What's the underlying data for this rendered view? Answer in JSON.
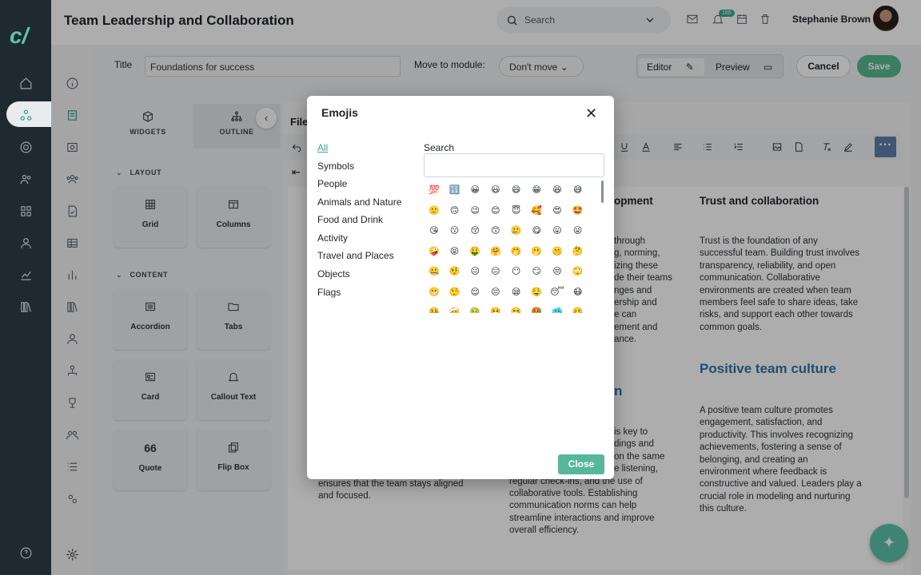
{
  "header": {
    "page_title": "Team Leadership and Collaboration",
    "search_placeholder": "Search",
    "notification_count": "165",
    "user_name": "Stephanie Brown"
  },
  "lesson": {
    "title_label": "Title",
    "title_value": "Foundations for success",
    "move_label": "Move to module:",
    "move_value": "Don't move",
    "editor_label": "Editor",
    "preview_label": "Preview",
    "cancel_label": "Cancel",
    "save_label": "Save"
  },
  "widgets": {
    "tabs": [
      "WIDGETS",
      "OUTLINE"
    ],
    "layout_label": "LAYOUT",
    "content_label": "CONTENT",
    "layout_items": [
      "Grid",
      "Columns"
    ],
    "content_items": [
      "Accordion",
      "Tabs",
      "Card",
      "Callout Text",
      "Quote",
      "Flip Box"
    ]
  },
  "editor": {
    "file_label": "File",
    "col2_heading": "opment",
    "col2_top": [
      "through",
      "g, norming,",
      "izing these",
      "de their teams",
      "nges and",
      "ership and",
      "e can",
      "ement and",
      "ance."
    ],
    "col2_mid_heading": "n",
    "col2_bottom": [
      "is key to",
      "dings and",
      "on the same",
      "e listening,",
      "regular check-ins, and the use of",
      "collaborative tools. Establishing",
      "communication norms can help",
      "streamline interactions and improve",
      "overall efficiency."
    ],
    "col1_bottom": [
      "ensures that the team stays aligned",
      "and focused."
    ],
    "trust_heading": "Trust and collaboration",
    "trust_text": [
      "Trust is the foundation of any",
      "successful team. Building trust involves",
      "transparency, reliability, and open",
      "communication. Collaborative",
      "environments are created when team",
      "members feel safe to share ideas, take",
      "risks, and support each other towards",
      "common goals."
    ],
    "culture_heading": "Positive team culture",
    "culture_text": [
      "A positive team culture promotes",
      "engagement, satisfaction, and",
      "productivity. This involves recognizing",
      "achievements, fostering a sense of",
      "belonging, and creating an",
      "environment where feedback is",
      "constructive and valued. Leaders play a",
      "crucial role in modeling and nurturing",
      "this culture."
    ]
  },
  "emoji_modal": {
    "title": "Emojis",
    "categories": [
      "All",
      "Symbols",
      "People",
      "Animals and Nature",
      "Food and Drink",
      "Activity",
      "Travel and Places",
      "Objects",
      "Flags"
    ],
    "selected_category": "All",
    "search_label": "Search",
    "search_value": "",
    "emojis": [
      [
        "💯",
        "🔢",
        "😀",
        "😃",
        "😄",
        "😁",
        "😆",
        "😅"
      ],
      [
        "🙂",
        "🙃",
        "😉",
        "😊",
        "😇",
        "🥰",
        "😍",
        "🤩"
      ],
      [
        "😘",
        "😗",
        "😚",
        "😙",
        "🥲",
        "😋",
        "😛",
        "😜"
      ],
      [
        "🤪",
        "😝",
        "🤑",
        "🤗",
        "🤭",
        "🫢",
        "🤫",
        "🤔"
      ],
      [
        "🤐",
        "🤨",
        "😐",
        "😑",
        "😶",
        "😏",
        "😒",
        "🙄"
      ],
      [
        "😬",
        "🤥",
        "😌",
        "😔",
        "😪",
        "🤤",
        "😴",
        "😷"
      ],
      [
        "🤒",
        "🤕",
        "🤢",
        "🤮",
        "🤧",
        "🥵",
        "🥶",
        "🥴"
      ]
    ],
    "close_label": "Close"
  },
  "colors": {
    "accent": "#3aa98f",
    "save": "#58b892",
    "heading_blue": "#2e74a8",
    "rail": "#1e2a30"
  }
}
